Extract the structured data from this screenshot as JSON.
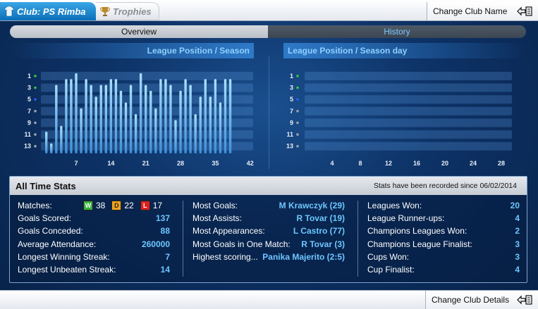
{
  "tabs": {
    "club_label": "Club: PS Rimba",
    "trophies_label": "Trophies"
  },
  "header": {
    "change_club_name": "Change Club Name"
  },
  "segmented": {
    "overview": "Overview",
    "history": "History"
  },
  "chart_data": [
    {
      "type": "bar",
      "title": "League Position / Season",
      "y_ticks": [
        "1",
        "3",
        "5",
        "7",
        "9",
        "11",
        "13"
      ],
      "x_ticks": [
        "7",
        "14",
        "21",
        "28",
        "35",
        "42"
      ],
      "ylim": [
        14,
        1
      ],
      "positions": [
        11,
        13,
        3,
        10,
        2,
        2,
        1,
        7,
        2,
        3,
        5,
        3,
        3,
        2,
        2,
        4,
        6,
        3,
        8,
        1,
        3,
        4,
        7,
        2,
        2,
        3,
        9,
        4,
        2,
        3,
        8,
        5,
        2,
        5,
        2,
        6,
        2,
        2
      ],
      "tick_dot_colors": [
        "#37c83b",
        "#37c83b",
        "#2d5bff",
        "#9aa3ad",
        "#9aa3ad",
        "#9aa3ad",
        "#9aa3ad"
      ]
    },
    {
      "type": "bar",
      "title": "League Position / Season day",
      "y_ticks": [
        "1",
        "3",
        "5",
        "7",
        "9",
        "11",
        "13"
      ],
      "x_ticks": [
        "4",
        "8",
        "12",
        "16",
        "20",
        "24",
        "28"
      ],
      "ylim": [
        14,
        1
      ],
      "positions": [],
      "tick_dot_colors": [
        "#37c83b",
        "#37c83b",
        "#2d5bff",
        "#9aa3ad",
        "#9aa3ad",
        "#9aa3ad",
        "#9aa3ad"
      ]
    }
  ],
  "stats": {
    "title": "All Time Stats",
    "since": "Stats have been recorded since 06/02/2014",
    "col1": {
      "matches_label": "Matches:",
      "w_badge": "W",
      "w": "38",
      "d_badge": "D",
      "d": "22",
      "l_badge": "L",
      "l": "17",
      "rows": [
        {
          "label": "Goals Scored:",
          "value": "137"
        },
        {
          "label": "Goals Conceded:",
          "value": "88"
        },
        {
          "label": "Average Attendance:",
          "value": "260000"
        },
        {
          "label": "Longest Winning Streak:",
          "value": "7"
        },
        {
          "label": "Longest Unbeaten Streak:",
          "value": "14"
        }
      ]
    },
    "col2": [
      {
        "label": "Most Goals:",
        "value": "M Krawczyk (29)"
      },
      {
        "label": "Most Assists:",
        "value": "R Tovar (19)"
      },
      {
        "label": "Most Appearances:",
        "value": "L Castro (77)"
      },
      {
        "label": "Most Goals in One Match:",
        "value": "R Tovar (3)"
      },
      {
        "label": "Highest scoring...",
        "value": "Panika Majerito (2:5)"
      }
    ],
    "col3": [
      {
        "label": "Leagues Won:",
        "value": "20"
      },
      {
        "label": "League Runner-ups:",
        "value": "4"
      },
      {
        "label": "Champions Leagues Won:",
        "value": "2"
      },
      {
        "label": "Champions League Finalist:",
        "value": "3"
      },
      {
        "label": "Cups Won:",
        "value": "3"
      },
      {
        "label": "Cup Finalist:",
        "value": "4"
      }
    ]
  },
  "footer": {
    "change_club_details": "Change Club Details"
  }
}
